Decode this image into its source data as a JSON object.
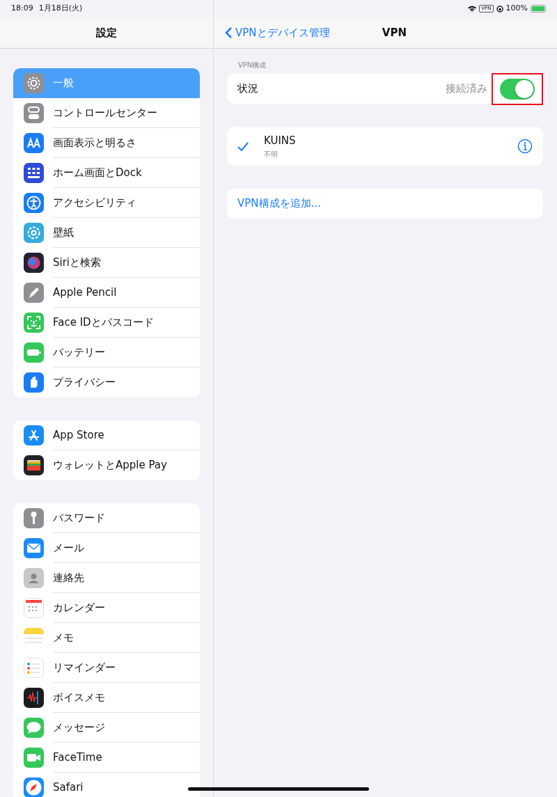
{
  "status_bar": {
    "time": "18:09",
    "date": "1月18日(火)",
    "vpn_badge": "VPN",
    "battery": "100%"
  },
  "sidebar": {
    "title": "設定",
    "groups": [
      {
        "items": [
          {
            "label": "一般",
            "color": "#8e8e93",
            "selected": true
          },
          {
            "label": "コントロールセンター",
            "color": "#8e8e93",
            "selected": false
          },
          {
            "label": "画面表示と明るさ",
            "color": "#1a7cf5",
            "selected": false
          },
          {
            "label": "ホーム画面とDock",
            "color": "#2f4bd6",
            "selected": false
          },
          {
            "label": "アクセシビリティ",
            "color": "#1a7cf5",
            "selected": false
          },
          {
            "label": "壁紙",
            "color": "#37aadc",
            "selected": false
          },
          {
            "label": "Siriと検索",
            "color": "#222233",
            "selected": false
          },
          {
            "label": "Apple Pencil",
            "color": "#8e8e93",
            "selected": false
          },
          {
            "label": "Face IDとパスコード",
            "color": "#34c759",
            "selected": false
          },
          {
            "label": "バッテリー",
            "color": "#34c759",
            "selected": false
          },
          {
            "label": "プライバシー",
            "color": "#1a7cf5",
            "selected": false
          }
        ]
      },
      {
        "items": [
          {
            "label": "App Store",
            "color": "#1a8cf5",
            "selected": false
          },
          {
            "label": "ウォレットとApple Pay",
            "color": "#222222",
            "selected": false
          }
        ]
      },
      {
        "items": [
          {
            "label": "パスワード",
            "color": "#8e8e93",
            "selected": false
          },
          {
            "label": "メール",
            "color": "#1a8cf5",
            "selected": false
          },
          {
            "label": "連絡先",
            "color": "#c8c8c8",
            "selected": false
          },
          {
            "label": "カレンダー",
            "color": "#ffffff",
            "selected": false
          },
          {
            "label": "メモ",
            "color": "#fcd440",
            "selected": false
          },
          {
            "label": "リマインダー",
            "color": "#ffffff",
            "selected": false
          },
          {
            "label": "ボイスメモ",
            "color": "#1c1c1e",
            "selected": false
          },
          {
            "label": "メッセージ",
            "color": "#34c759",
            "selected": false
          },
          {
            "label": "FaceTime",
            "color": "#34c759",
            "selected": false
          },
          {
            "label": "Safari",
            "color": "#1a8cf5",
            "selected": false
          }
        ]
      }
    ]
  },
  "detail": {
    "back_label": "VPNとデバイス管理",
    "title": "VPN",
    "section_header": "VPN構成",
    "status": {
      "label": "状況",
      "value": "接続済み",
      "on": true,
      "highlighted": true
    },
    "configurations": [
      {
        "name": "KUINS",
        "subtitle": "不明",
        "selected": true
      }
    ],
    "add_label": "VPN構成を追加..."
  }
}
